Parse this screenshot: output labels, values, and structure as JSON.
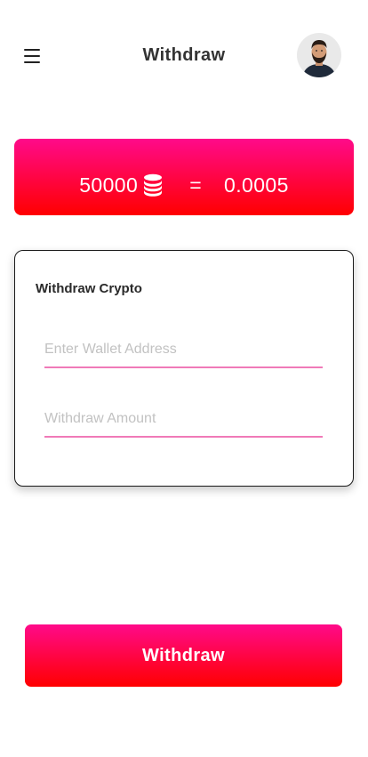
{
  "header": {
    "title": "Withdraw",
    "menu_icon": "hamburger-menu-icon",
    "avatar_icon": "user-avatar"
  },
  "balance": {
    "coins": "50000",
    "coin_icon": "coin-stack-icon",
    "equals": "=",
    "crypto_value": "0.0005"
  },
  "card": {
    "title": "Withdraw Crypto",
    "wallet_placeholder": "Enter Wallet Address",
    "amount_placeholder": "Withdraw Amount"
  },
  "actions": {
    "withdraw_label": "Withdraw"
  },
  "colors": {
    "gradient_top": "#ff0a8a",
    "gradient_bottom": "#ff0000",
    "field_underline": "#f07ab8",
    "title_text": "#333333"
  }
}
